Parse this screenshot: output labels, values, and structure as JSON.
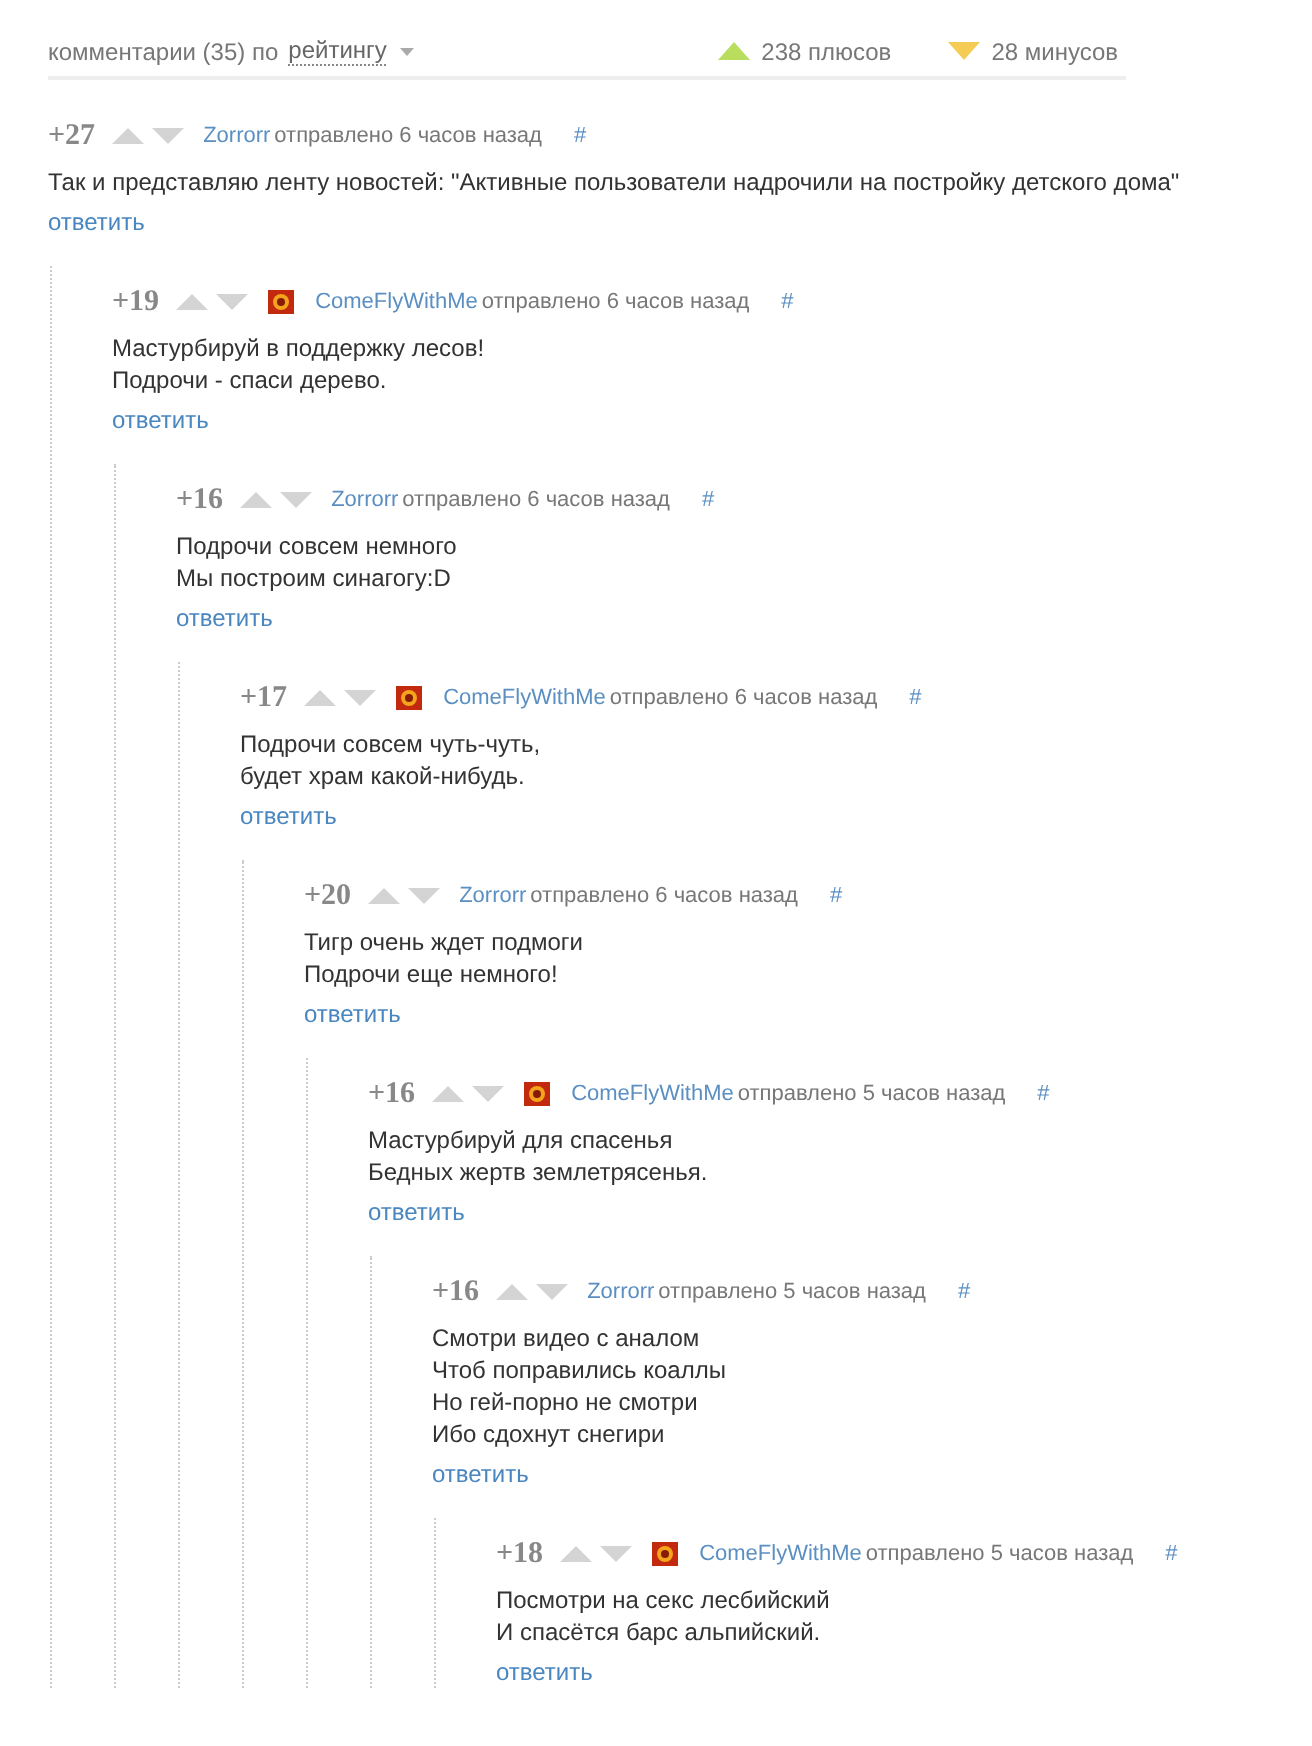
{
  "header": {
    "label": "комментарии (35) по",
    "sort": "рейтингу",
    "pluses": "238 плюсов",
    "minuses": "28 минусов"
  },
  "comments": [
    {
      "rating": "+27",
      "author": "Zorrorr",
      "avatar": false,
      "time": "отправлено 6 часов назад",
      "anchor": "#",
      "text": "Так и представляю ленту новостей: \"Активные пользователи надрочили на постройку детского дома\"",
      "reply": "ответить",
      "children": [
        {
          "rating": "+19",
          "author": "ComeFlyWithMe",
          "avatar": true,
          "time": "отправлено 6 часов назад",
          "anchor": "#",
          "text": "Мастурбируй в поддержку лесов!\nПодрочи - спаси дерево.",
          "reply": "ответить",
          "children": [
            {
              "rating": "+16",
              "author": "Zorrorr",
              "avatar": false,
              "time": "отправлено 6 часов назад",
              "anchor": "#",
              "text": "Подрочи совсем немного\nМы построим синагогу:D",
              "reply": "ответить",
              "children": [
                {
                  "rating": "+17",
                  "author": "ComeFlyWithMe",
                  "avatar": true,
                  "time": "отправлено 6 часов назад",
                  "anchor": "#",
                  "text": "Подрочи совсем чуть-чуть,\nбудет храм какой-нибудь.",
                  "reply": "ответить",
                  "children": [
                    {
                      "rating": "+20",
                      "author": "Zorrorr",
                      "avatar": false,
                      "time": "отправлено 6 часов назад",
                      "anchor": "#",
                      "text": "Тигр очень ждет подмоги\nПодрочи еще немного!",
                      "reply": "ответить",
                      "children": [
                        {
                          "rating": "+16",
                          "author": "ComeFlyWithMe",
                          "avatar": true,
                          "time": "отправлено 5 часов назад",
                          "anchor": "#",
                          "text": "Мастурбируй для спасенья\nБедных жертв землетрясенья.",
                          "reply": "ответить",
                          "children": [
                            {
                              "rating": "+16",
                              "author": "Zorrorr",
                              "avatar": false,
                              "time": "отправлено 5 часов назад",
                              "anchor": "#",
                              "text": "Смотри видео с аналом\nЧтоб поправились коаллы\nНо гей-порно не смотри\nИбо сдохнут снегири",
                              "reply": "ответить",
                              "children": [
                                {
                                  "rating": "+18",
                                  "author": "ComeFlyWithMe",
                                  "avatar": true,
                                  "time": "отправлено 5 часов назад",
                                  "anchor": "#",
                                  "text": "Посмотри на секс лесбийский\nИ спасётся барс альпийский.",
                                  "reply": "ответить"
                                }
                              ]
                            }
                          ]
                        }
                      ]
                    }
                  ]
                }
              ]
            }
          ]
        }
      ]
    }
  ]
}
